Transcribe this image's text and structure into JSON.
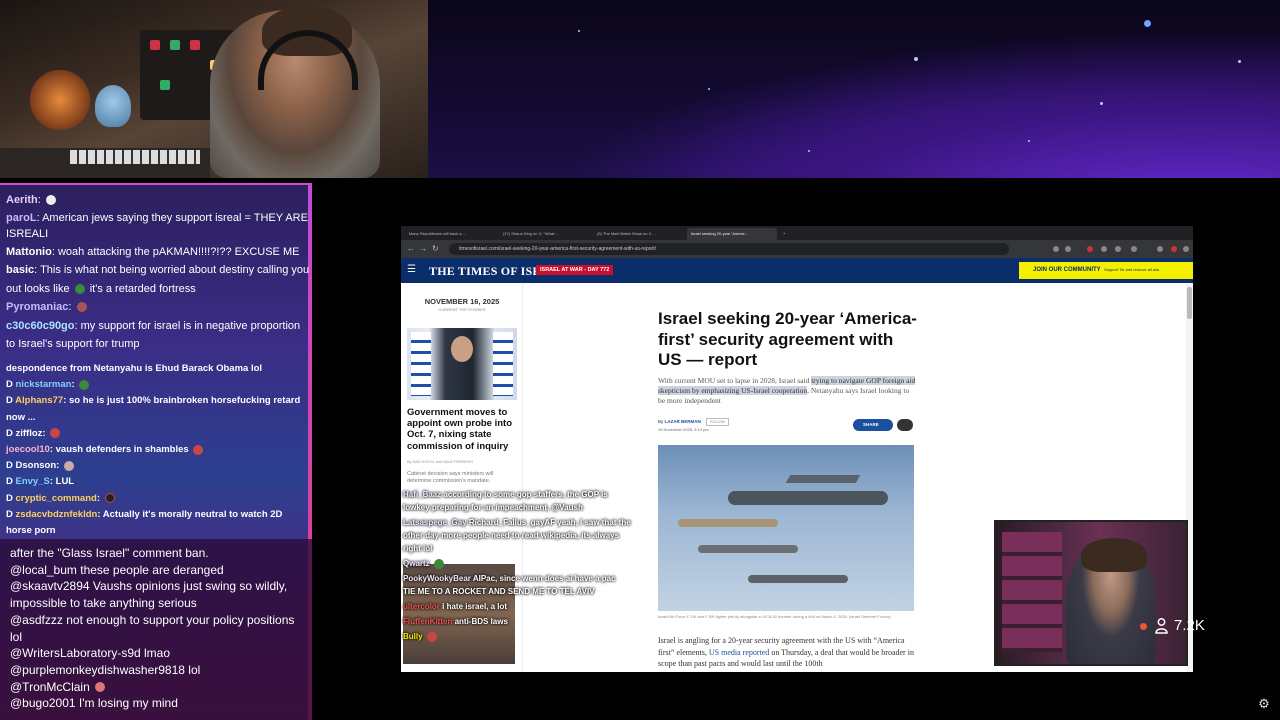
{
  "chat_top": [
    {
      "user": "Aerith",
      "color": "#e6ccff",
      "text": ""
    },
    {
      "user": "paroL",
      "color": "#c8b8ff",
      "text": "American jews saying they support isreal = THEY ARE ISREALI"
    },
    {
      "user": "Mattonio",
      "color": "#ffffff",
      "text": "woah attacking the pAKMAN!!!!?!?? EXCUSE ME"
    },
    {
      "user": "basic",
      "color": "#ffffff",
      "text": "This is what not being worried about destiny calling you out looks like",
      "suffix": "it's a retarded fortress"
    },
    {
      "user": "Pyromaniac",
      "color": "#c8b8ff",
      "text": ""
    },
    {
      "user": "c30c60c90go",
      "color": "#a8e4ff",
      "text": "my support for israel is in negative proportion to Israel's support for trump"
    }
  ],
  "chat_mid": [
    {
      "user": "",
      "color": "#ffffff",
      "text": "despondence from Netanyahu is Ehud Barack Obama lol"
    },
    {
      "user": "nickstarman",
      "color": "#7fd0ff",
      "text": ""
    },
    {
      "user": "Alphans77",
      "color": "#ffd060",
      "text": "so he is just 100% brainbroken horsefucking retard now ..."
    },
    {
      "user": "ziffloz",
      "color": "#ffffff",
      "text": ""
    },
    {
      "user": "joecool10",
      "color": "#ffb0d0",
      "text": "vaush defenders in shambles"
    },
    {
      "user": "Dsonson",
      "color": "#ffffff",
      "text": ""
    },
    {
      "user": "Envy_S",
      "color": "#7fd0ff",
      "text": "LUL"
    },
    {
      "user": "cryptic_command",
      "color": "#ffd060",
      "text": ""
    },
    {
      "user": "zsdacvbdznfekldn",
      "color": "#ffd060",
      "text": "Actually it's morally neutral to watch 2D horse porn"
    }
  ],
  "chat_bottom": [
    {
      "user": "",
      "text": "after the \"Glass Israel\" comment ban."
    },
    {
      "user": "@local_bum",
      "text": "these people are deranged"
    },
    {
      "user": "@skaavtv2894",
      "text": "Vaushs opinions just swing so wildly, impossible to take anything serious"
    },
    {
      "user": "@asdfzzz",
      "text": "not enough to support your policy positions lol"
    },
    {
      "user": "@WritersLaboratory-s9d",
      "text": "lmao"
    },
    {
      "user": "@purplemonkeydishwasher9818",
      "text": "lol"
    },
    {
      "user": "@TronMcClain",
      "text": ""
    },
    {
      "user": "@bugo2001",
      "text": "I'm losing my mind"
    }
  ],
  "browser": {
    "tabs": [
      {
        "label": "Many Republicans will back a ..."
      },
      {
        "label": "(17) Shaun King on X: \"What ..."
      },
      {
        "label": "(5) The Matt Walsh Show on X ..."
      },
      {
        "label": "Israel seeking 20-year 'Americ..."
      }
    ],
    "url": "timesofisrael.com/israel-seeking-20-year-america-first-security-agreement-with-us-report/"
  },
  "site": {
    "logo": "THE TIMES OF ISRAEL",
    "war_badge": "ISRAEL AT WAR - DAY 772",
    "join": "JOIN OUR COMMUNITY",
    "join_sub": "Support ToI and remove all ads"
  },
  "sidebar": {
    "date": "NOVEMBER 16, 2025",
    "sub": "CURRENT TOP STORIES",
    "headline": "Government moves to appoint own probe into Oct. 7, nixing state commission of inquiry",
    "byline": "By SAM SOKOL and NAVA FREIBERG",
    "desc": "Cabinet decision says ministers will determine commission's mandate,"
  },
  "article": {
    "title": "Israel seeking 20-year ‘America-first’ security agreement with US — report",
    "deck_pre": "With current MOU set to lapse in 2028, Israel said ",
    "deck_mark": "trying to navigate GOP foreign aid skepticism by emphasizing US-Israel cooperation",
    "deck_post": ", Netanyahu says Israel looking to be more independent",
    "author": "LAZAR BERMAN",
    "follow": "FOLLOW",
    "date": "15 November 2025, 5:14 pm",
    "share": "SHARE",
    "caption": "Israeli Air Force F-15I and F-35I fighter jets fly alongside a US B-52 bomber during a drill on March 4, 2025. (Israel Defense Forces)",
    "body_pre": "Israel is angling for a 20-year security agreement with the US with “America first” elements, ",
    "body_link": "US media reported",
    "body_post": " on Thursday, a deal that would be broader in scope than past pacts and would last until the 100th"
  },
  "overlay_chat": [
    {
      "user": "Hafi_Baaz",
      "cls": "u",
      "text": "according to some gop staffers, the GOP is lowkey preparing for an impeachment, @Vaush"
    },
    {
      "user": "Latsaspege_Gay",
      "cls": "u",
      "text": "Richard_Fallus_gayAF yeah, I saw that the other day more people need to read wikipedia, its always right lol"
    },
    {
      "user": "Qwartz",
      "cls": "u",
      "text": ""
    },
    {
      "user": "PookyWookyBear",
      "cls": "u",
      "text": "AIPac, since wenn does ai have a pac"
    },
    {
      "user": "",
      "cls": "u",
      "text": "TIE ME TO A ROCKET AND SEND ME TO TEL AVIV"
    },
    {
      "user": "ultercolor",
      "cls": "u2",
      "text": "i hate israel, a lot"
    },
    {
      "user": "FluffenKitten",
      "cls": "u2",
      "text": "anti-BDS laws"
    },
    {
      "user": "Bully",
      "cls": "u3",
      "text": ""
    }
  ],
  "viewers": "7.2K",
  "colors": {
    "accent": "#0b2d6a",
    "war": "#c8102e",
    "join": "#f3f000",
    "link": "#1b4fa0"
  }
}
